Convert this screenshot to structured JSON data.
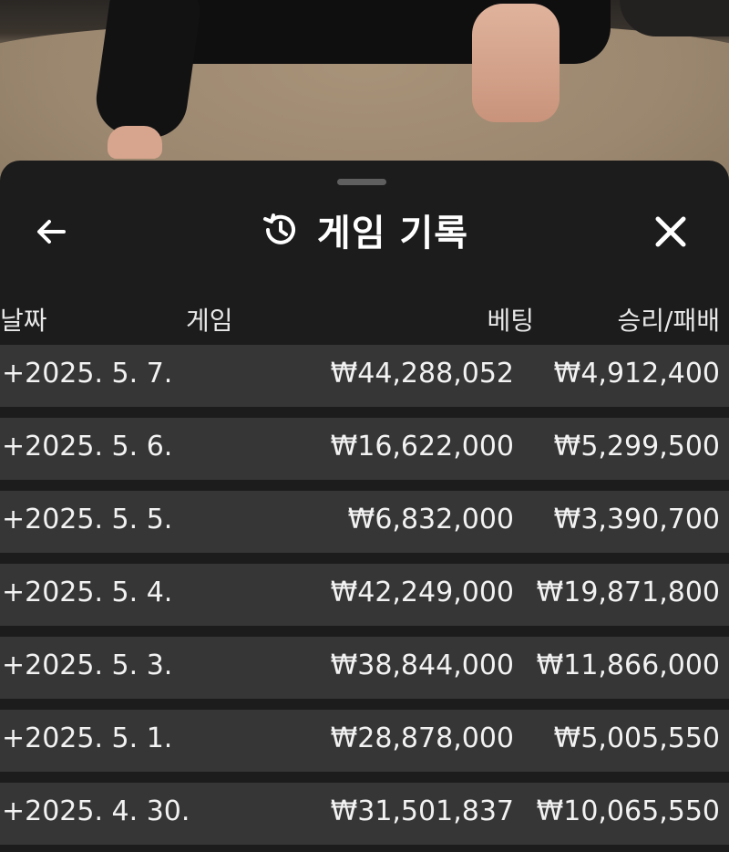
{
  "sheet": {
    "title": "게임 기록",
    "back_icon": "arrow-left-icon",
    "history_icon": "history-icon",
    "close_icon": "close-icon"
  },
  "columns": {
    "date": "날짜",
    "game": "게임",
    "bet": "베팅",
    "win_loss": "승리/패배"
  },
  "rows": [
    {
      "date": "+2025. 5. 7.",
      "game": "",
      "bet": "₩44,288,052",
      "win_loss": "₩4,912,400"
    },
    {
      "date": "+2025. 5. 6.",
      "game": "",
      "bet": "₩16,622,000",
      "win_loss": "₩5,299,500"
    },
    {
      "date": "+2025. 5. 5.",
      "game": "",
      "bet": "₩6,832,000",
      "win_loss": "₩3,390,700"
    },
    {
      "date": "+2025. 5. 4.",
      "game": "",
      "bet": "₩42,249,000",
      "win_loss": "₩19,871,800"
    },
    {
      "date": "+2025. 5. 3.",
      "game": "",
      "bet": "₩38,844,000",
      "win_loss": "₩11,866,000"
    },
    {
      "date": "+2025. 5. 1.",
      "game": "",
      "bet": "₩28,878,000",
      "win_loss": "₩5,005,550"
    },
    {
      "date": "+2025. 4. 30.",
      "game": "",
      "bet": "₩31,501,837",
      "win_loss": "₩10,065,550"
    }
  ],
  "colors": {
    "sheet_bg": "#1c1c1c",
    "row_bg": "#363636",
    "text": "#f2f2f2"
  }
}
